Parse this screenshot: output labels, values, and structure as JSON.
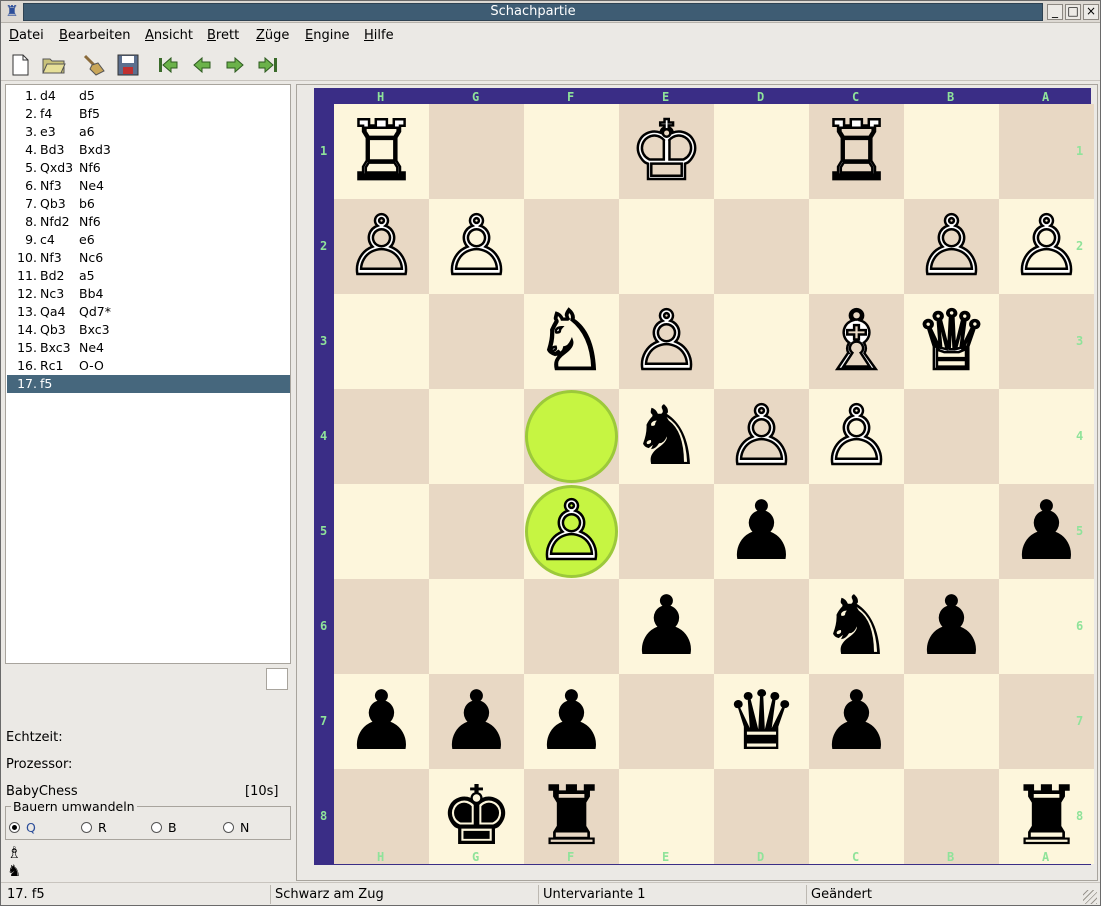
{
  "window": {
    "title": "Schachpartie",
    "app_icon": "rook-icon",
    "buttons": [
      "_",
      "□",
      "×"
    ]
  },
  "menu": [
    {
      "label": "Datei",
      "u": "D",
      "rest": "atei"
    },
    {
      "label": "Bearbeiten",
      "u": "B",
      "rest": "earbeiten"
    },
    {
      "label": "Ansicht",
      "u": "A",
      "rest": "nsicht"
    },
    {
      "label": "Brett",
      "u": "B",
      "rest": "rett"
    },
    {
      "label": "Züge",
      "u": "Z",
      "rest": "üge"
    },
    {
      "label": "Engine",
      "u": "E",
      "rest": "ngine"
    },
    {
      "label": "Hilfe",
      "u": "H",
      "rest": "ilfe"
    }
  ],
  "toolbar": [
    "new-file-icon",
    "open-folder-icon",
    "broom-icon",
    "save-disk-icon",
    "first-move-icon",
    "prev-move-icon",
    "next-move-icon",
    "last-move-icon"
  ],
  "moves": [
    {
      "n": "1.",
      "w": "d4",
      "b": "d5"
    },
    {
      "n": "2.",
      "w": "f4",
      "b": "Bf5"
    },
    {
      "n": "3.",
      "w": "e3",
      "b": "a6"
    },
    {
      "n": "4.",
      "w": "Bd3",
      "b": "Bxd3"
    },
    {
      "n": "5.",
      "w": "Qxd3",
      "b": "Nf6"
    },
    {
      "n": "6.",
      "w": "Nf3",
      "b": "Ne4"
    },
    {
      "n": "7.",
      "w": "Qb3",
      "b": "b6"
    },
    {
      "n": "8.",
      "w": "Nfd2",
      "b": "Nf6"
    },
    {
      "n": "9.",
      "w": "c4",
      "b": "e6"
    },
    {
      "n": "10.",
      "w": "Nf3",
      "b": "Nc6"
    },
    {
      "n": "11.",
      "w": "Bd2",
      "b": "a5"
    },
    {
      "n": "12.",
      "w": "Nc3",
      "b": "Bb4"
    },
    {
      "n": "13.",
      "w": "Qa4",
      "b": "Qd7*"
    },
    {
      "n": "14.",
      "w": "Qb3",
      "b": "Bxc3"
    },
    {
      "n": "15.",
      "w": "Bxc3",
      "b": "Ne4"
    },
    {
      "n": "16.",
      "w": "Rc1",
      "b": "O-O"
    },
    {
      "n": "17.",
      "w": "f5",
      "b": ""
    }
  ],
  "selected_move": 16,
  "info": {
    "realtime_label": "Echtzeit:",
    "processor_label": "Prozessor:",
    "engine_name": "BabyChess",
    "engine_time": "[10s]"
  },
  "promotion": {
    "legend": "Bauern umwandeln",
    "options": [
      "Q",
      "R",
      "B",
      "N"
    ],
    "selected": "Q"
  },
  "turn_icons": [
    "white-bishop-icon",
    "black-knight-icon"
  ],
  "board": {
    "files": [
      "H",
      "G",
      "F",
      "E",
      "D",
      "C",
      "B",
      "A"
    ],
    "ranks": [
      "1",
      "2",
      "3",
      "4",
      "5",
      "6",
      "7",
      "8"
    ],
    "colors": {
      "light": "#fdf6dc",
      "dark": "#e8d8c4",
      "frame": "#3a2d86",
      "coord": "#8fe39a",
      "highlight": "#c6f542"
    },
    "highlights": [
      "f4",
      "f5"
    ],
    "pieces": [
      {
        "sq": "h1",
        "p": "R",
        "c": "w"
      },
      {
        "sq": "e1",
        "p": "K",
        "c": "w"
      },
      {
        "sq": "c1",
        "p": "R",
        "c": "w"
      },
      {
        "sq": "h2",
        "p": "P",
        "c": "w"
      },
      {
        "sq": "g2",
        "p": "P",
        "c": "w"
      },
      {
        "sq": "b2",
        "p": "P",
        "c": "w"
      },
      {
        "sq": "a2",
        "p": "P",
        "c": "w"
      },
      {
        "sq": "f3",
        "p": "N",
        "c": "w"
      },
      {
        "sq": "e3",
        "p": "P",
        "c": "w"
      },
      {
        "sq": "c3",
        "p": "B",
        "c": "w"
      },
      {
        "sq": "b3",
        "p": "Q",
        "c": "w"
      },
      {
        "sq": "e4",
        "p": "N",
        "c": "b"
      },
      {
        "sq": "d4",
        "p": "P",
        "c": "w"
      },
      {
        "sq": "c4",
        "p": "P",
        "c": "w"
      },
      {
        "sq": "f5",
        "p": "P",
        "c": "w"
      },
      {
        "sq": "d5",
        "p": "P",
        "c": "b"
      },
      {
        "sq": "a5",
        "p": "P",
        "c": "b"
      },
      {
        "sq": "e6",
        "p": "P",
        "c": "b"
      },
      {
        "sq": "c6",
        "p": "N",
        "c": "b"
      },
      {
        "sq": "b6",
        "p": "P",
        "c": "b"
      },
      {
        "sq": "h7",
        "p": "P",
        "c": "b"
      },
      {
        "sq": "g7",
        "p": "P",
        "c": "b"
      },
      {
        "sq": "f7",
        "p": "P",
        "c": "b"
      },
      {
        "sq": "d7",
        "p": "Q",
        "c": "b"
      },
      {
        "sq": "c7",
        "p": "P",
        "c": "b"
      },
      {
        "sq": "g8",
        "p": "K",
        "c": "b"
      },
      {
        "sq": "f8",
        "p": "R",
        "c": "b"
      },
      {
        "sq": "a8",
        "p": "R",
        "c": "b"
      }
    ]
  },
  "status": [
    "17. f5",
    "Schwarz am Zug",
    "Untervariante 1",
    "Geändert"
  ]
}
